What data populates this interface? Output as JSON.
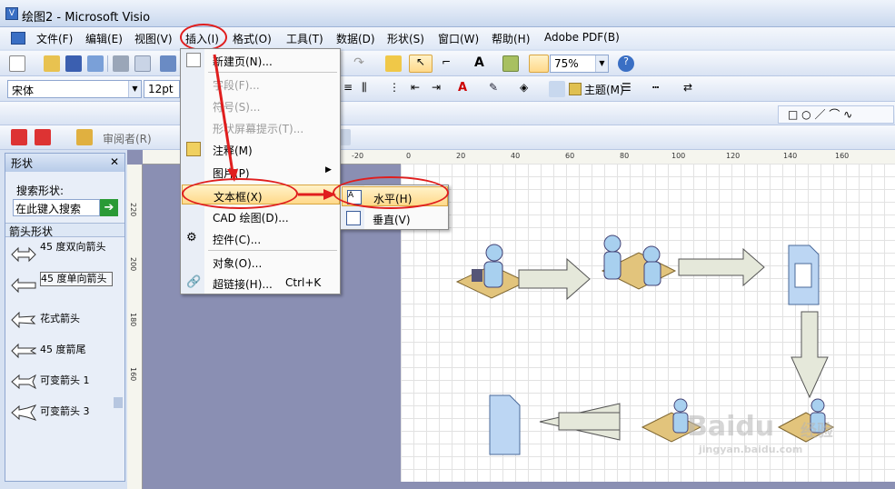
{
  "window": {
    "title": "绘图2 - Microsoft Visio"
  },
  "menubar": {
    "items": [
      "文件(F)",
      "编辑(E)",
      "视图(V)",
      "插入(I)",
      "格式(O)",
      "工具(T)",
      "数据(D)",
      "形状(S)",
      "窗口(W)",
      "帮助(H)",
      "Adobe PDF(B)"
    ]
  },
  "toolbar": {
    "zoom": "75%",
    "font_name": "宋体",
    "font_size": "12pt",
    "theme_label": "主题(M)",
    "reviewer_label": "审阅者(R)"
  },
  "insert_menu": {
    "items": [
      {
        "label": "新建页(N)...",
        "disabled": false
      },
      {
        "label": "字段(F)...",
        "disabled": true
      },
      {
        "label": "符号(S)...",
        "disabled": true
      },
      {
        "label": "形状屏幕提示(T)...",
        "disabled": true
      },
      {
        "label": "注释(M)",
        "disabled": false
      },
      {
        "label": "图片(P)",
        "disabled": false
      },
      {
        "label": "文本框(X)",
        "disabled": false,
        "highlighted": true
      },
      {
        "label": "CAD 绘图(D)...",
        "disabled": false
      },
      {
        "label": "控件(C)...",
        "disabled": false
      },
      {
        "label": "对象(O)...",
        "disabled": false
      },
      {
        "label": "超链接(H)...",
        "disabled": false,
        "shortcut": "Ctrl+K"
      }
    ]
  },
  "submenu": {
    "items": [
      "水平(H)",
      "垂直(V)"
    ]
  },
  "shapes_panel": {
    "title": "形状",
    "search_label": "搜索形状:",
    "search_placeholder": "在此键入搜索",
    "stencil_title": "箭头形状",
    "shapes": [
      "45 度双向箭头",
      "45 度单向箭头",
      "花式箭头",
      "45 度箭尾",
      "可变箭头 1",
      "可变箭头 3"
    ]
  },
  "rulers": {
    "h_ticks": [
      "-20",
      "0",
      "20",
      "40",
      "60",
      "80",
      "100",
      "120",
      "140",
      "160"
    ],
    "v_ticks": [
      "220",
      "200",
      "180",
      "160"
    ]
  },
  "watermark": {
    "brand": "Baidu",
    "sub": "经验",
    "url": "jingyan.baidu.com"
  },
  "colors": {
    "highlight": "#ffd98a",
    "annotation_red": "#e01e1e",
    "canvas_bg": "#8a8fb3"
  }
}
